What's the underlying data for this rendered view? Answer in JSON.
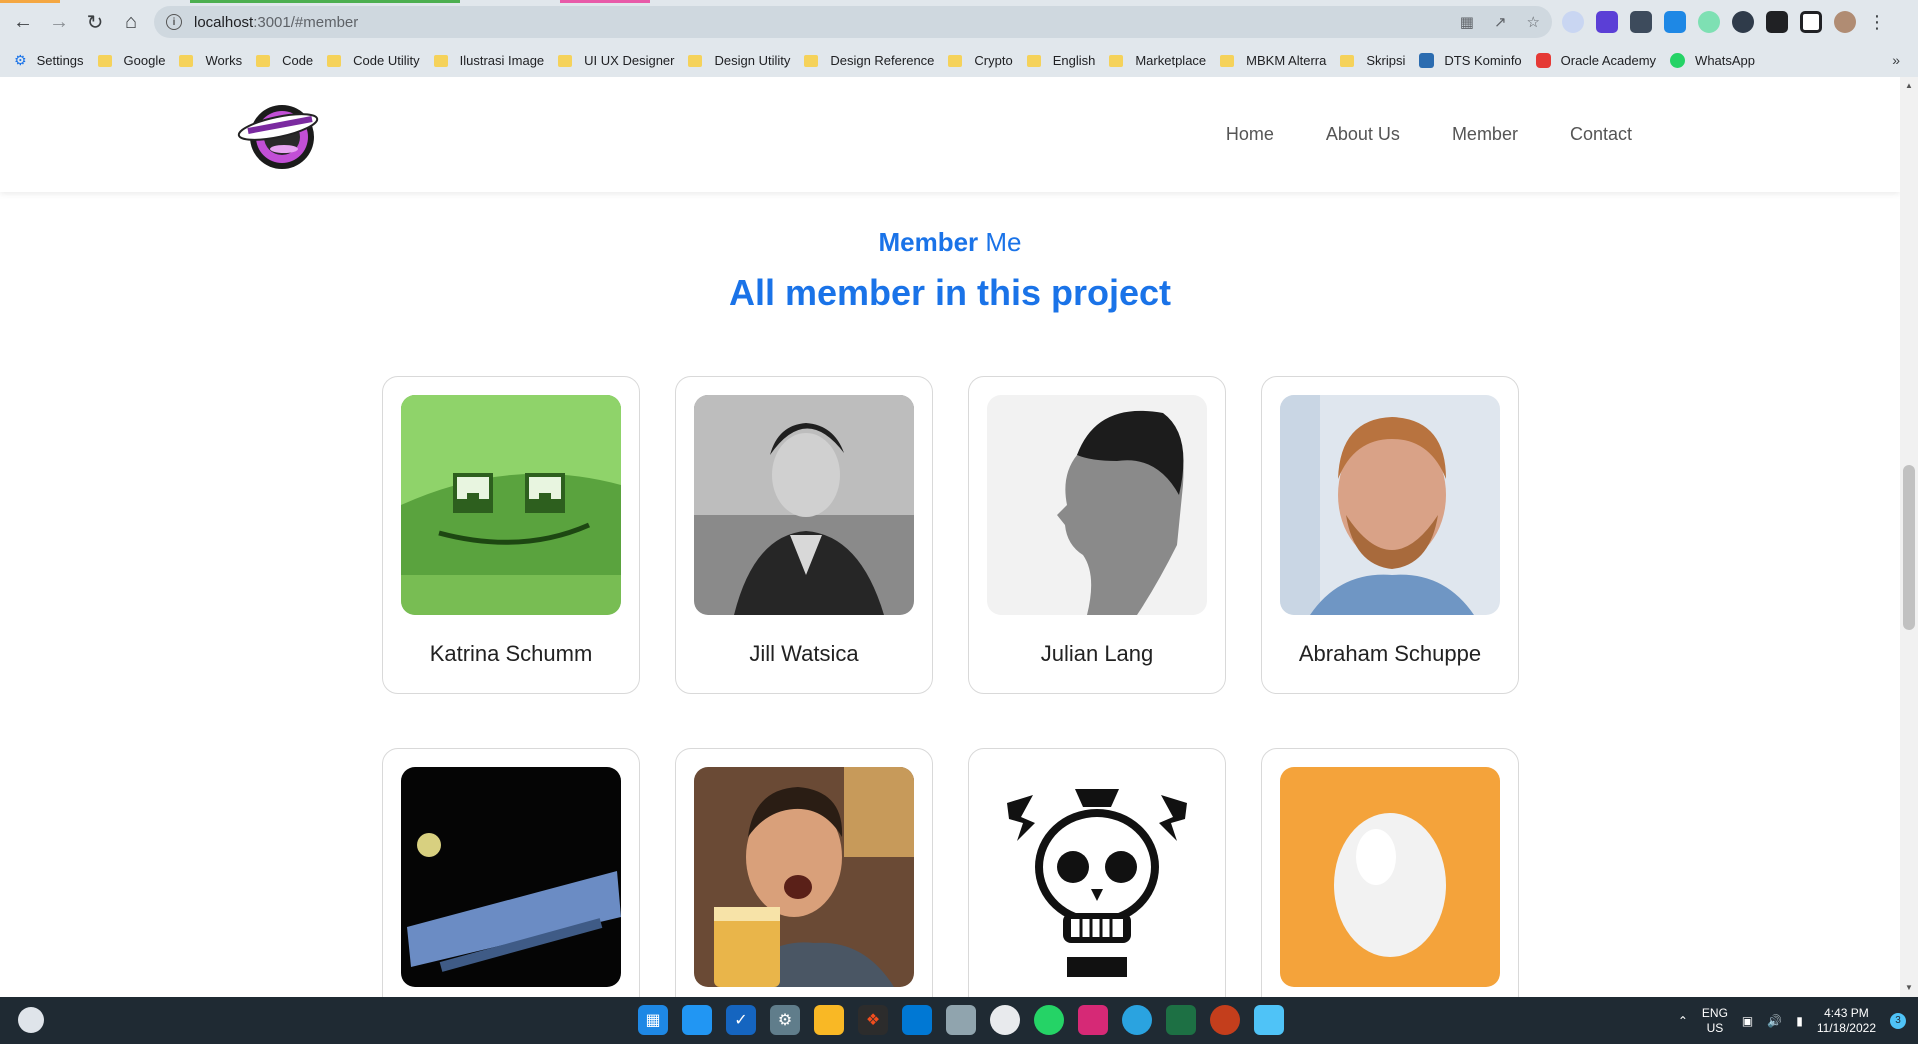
{
  "browser": {
    "url_host": "localhost",
    "url_path": ":3001/#member",
    "bookmarks": [
      "Settings",
      "Google",
      "Works",
      "Code",
      "Code Utility",
      "Ilustrasi Image",
      "UI UX Designer",
      "Design Utility",
      "Design Reference",
      "Crypto",
      "English",
      "Marketplace",
      "MBKM Alterra",
      "Skripsi",
      "DTS Kominfo",
      "Oracle Academy",
      "WhatsApp"
    ],
    "more": "»"
  },
  "nav": {
    "items": [
      "Home",
      "About Us",
      "Member",
      "Contact"
    ]
  },
  "section": {
    "kicker_bold": "Member",
    "kicker_light": " Me",
    "title": "All member in this project"
  },
  "members": [
    {
      "name": "Katrina Schumm",
      "avatar": "green-smiley-box-avatar"
    },
    {
      "name": "Jill Watsica",
      "avatar": "bw-portrait-avatar"
    },
    {
      "name": "Julian Lang",
      "avatar": "bw-profile-avatar"
    },
    {
      "name": "Abraham Schuppe",
      "avatar": "bearded-portrait-avatar"
    },
    {
      "name": "",
      "avatar": "gizmeb-logo-avatar"
    },
    {
      "name": "",
      "avatar": "beer-selfie-avatar"
    },
    {
      "name": "",
      "avatar": "skull-logo-avatar"
    },
    {
      "name": "",
      "avatar": "egg-avatar"
    }
  ],
  "taskbar": {
    "lang_top": "ENG",
    "lang_bottom": "US",
    "time": "4:43 PM",
    "date": "11/18/2022",
    "notif_count": "3"
  },
  "colors": {
    "accent": "#1a73e8",
    "chrome": "#e1e7ec",
    "taskbar": "#1f2a33"
  }
}
